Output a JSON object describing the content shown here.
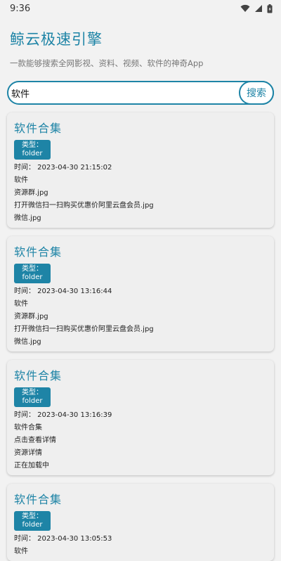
{
  "status_bar": {
    "time": "9:36"
  },
  "header": {
    "title": "鲸云极速引擎",
    "subtitle": "一款能够搜索全网影视、资料、视频、软件的神奇App"
  },
  "search": {
    "value": "软件",
    "button_label": "搜索"
  },
  "colors": {
    "accent": "#1e84a6",
    "background": "#f2f2f2",
    "card": "#efefef"
  },
  "results": [
    {
      "title": "软件合集",
      "type_label": "类型：",
      "type_value": "folder",
      "time": "时间：  2023-04-30 21:15:02",
      "lines": [
        "软件",
        "资源群.jpg",
        "打开微信扫一扫购买优惠价阿里云盘会员.jpg",
        "微信.jpg"
      ]
    },
    {
      "title": "软件合集",
      "type_label": "类型：",
      "type_value": "folder",
      "time": "时间：  2023-04-30 13:16:44",
      "lines": [
        "软件",
        "资源群.jpg",
        "打开微信扫一扫购买优惠价阿里云盘会员.jpg",
        "微信.jpg"
      ]
    },
    {
      "title": "软件合集",
      "type_label": "类型：",
      "type_value": "folder",
      "time": "时间：  2023-04-30 13:16:39",
      "lines": [
        "软件合集",
        "点击查看详情",
        "资源详情",
        "正在加载中"
      ]
    },
    {
      "title": "软件合集",
      "type_label": "类型：",
      "type_value": "folder",
      "time": "时间：  2023-04-30 13:05:53",
      "lines": [
        "软件"
      ]
    }
  ]
}
